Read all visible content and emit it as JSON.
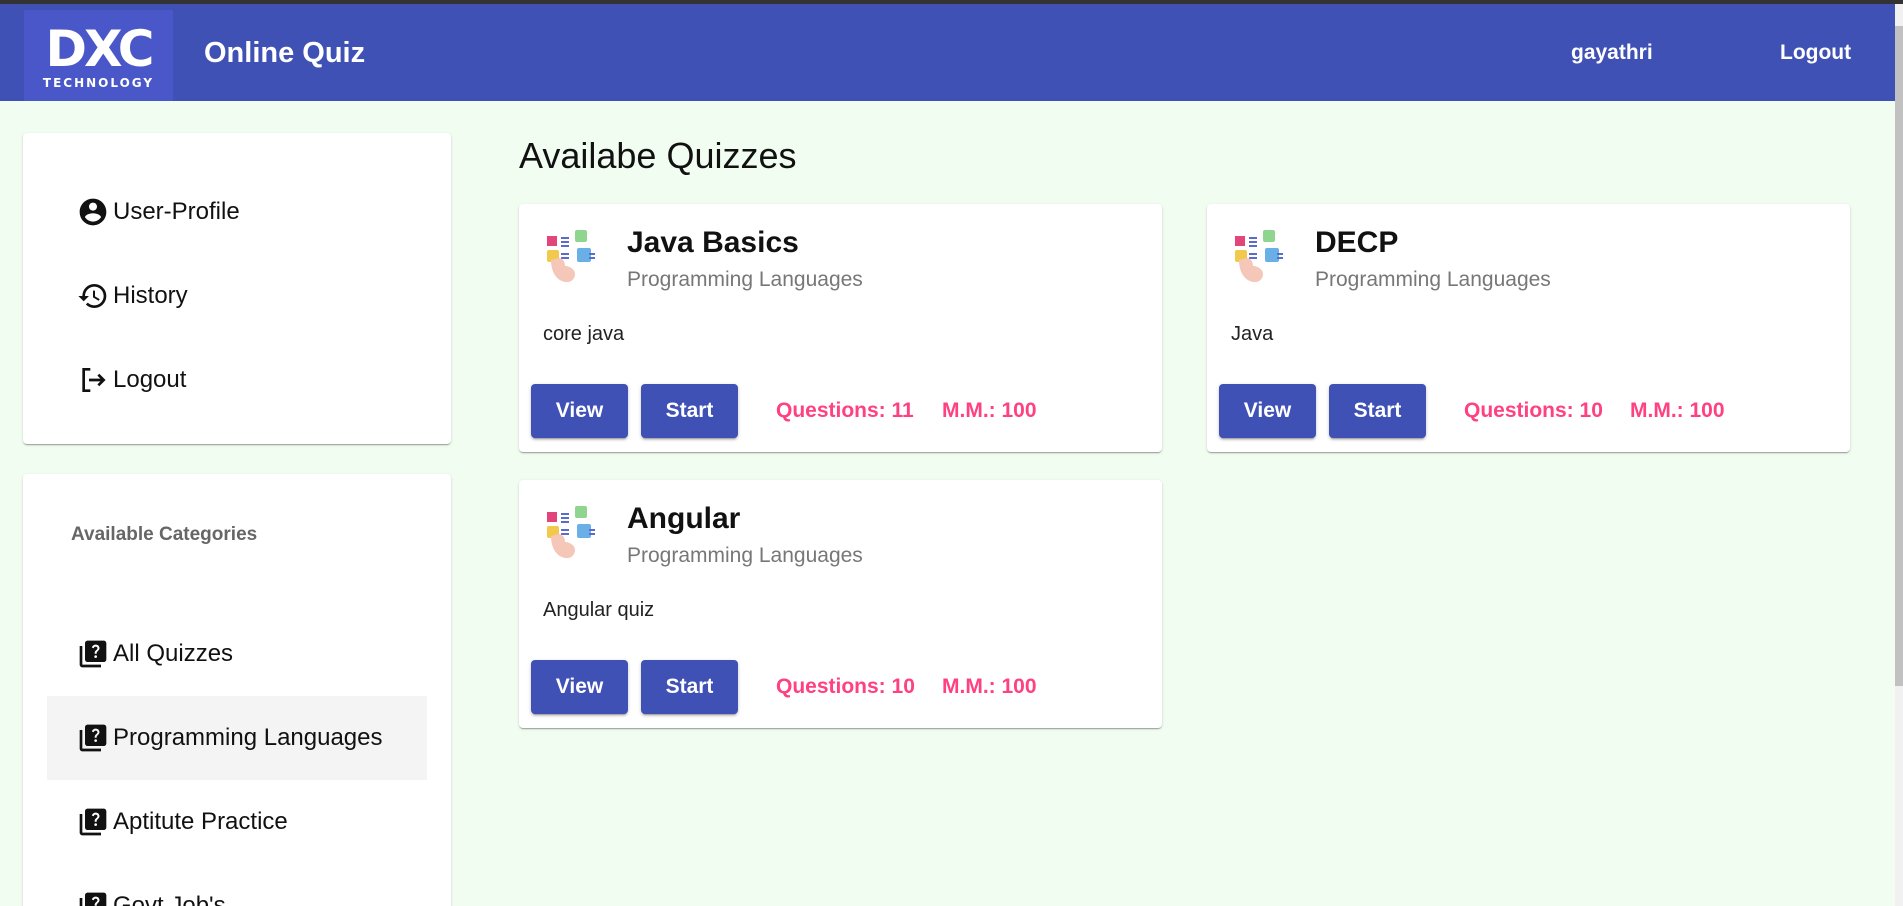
{
  "header": {
    "logo_main": "DXC",
    "logo_sub": "TECHNOLOGY",
    "app_title": "Online Quiz",
    "user_label": "gayathri",
    "logout_label": "Logout",
    "color": "#3f51b5"
  },
  "sidebar": {
    "menu": [
      {
        "label": "User-Profile",
        "icon": "account-circle-icon"
      },
      {
        "label": "History",
        "icon": "history-icon"
      },
      {
        "label": "Logout",
        "icon": "logout-icon"
      }
    ],
    "categories_heading": "Available Categories",
    "categories": [
      {
        "label": "All Quizzes",
        "icon": "quiz-icon",
        "active": false
      },
      {
        "label": "Programming Languages",
        "icon": "quiz-icon",
        "active": true
      },
      {
        "label": "Aptitute Practice",
        "icon": "quiz-icon",
        "active": false
      },
      {
        "label": "Govt.Job's",
        "icon": "quiz-icon",
        "active": false
      }
    ]
  },
  "main": {
    "title": "Availabe Quizzes",
    "quizzes": [
      {
        "title": "Java Basics",
        "category": "Programming Languages",
        "description": "core java",
        "view_label": "View",
        "start_label": "Start",
        "questions_label": "Questions: ",
        "questions": "11",
        "marks_label": "M.M.: ",
        "marks": "100"
      },
      {
        "title": "DECP",
        "category": "Programming Languages",
        "description": "Java",
        "view_label": "View",
        "start_label": "Start",
        "questions_label": "Questions: ",
        "questions": "10",
        "marks_label": "M.M.: ",
        "marks": "100"
      },
      {
        "title": "Angular",
        "category": "Programming Languages",
        "description": "Angular quiz",
        "view_label": "View",
        "start_label": "Start",
        "questions_label": "Questions: ",
        "questions": "10",
        "marks_label": "M.M.: ",
        "marks": "100"
      }
    ],
    "accent_color": "#ff4081",
    "background": "#f2fdf2"
  }
}
